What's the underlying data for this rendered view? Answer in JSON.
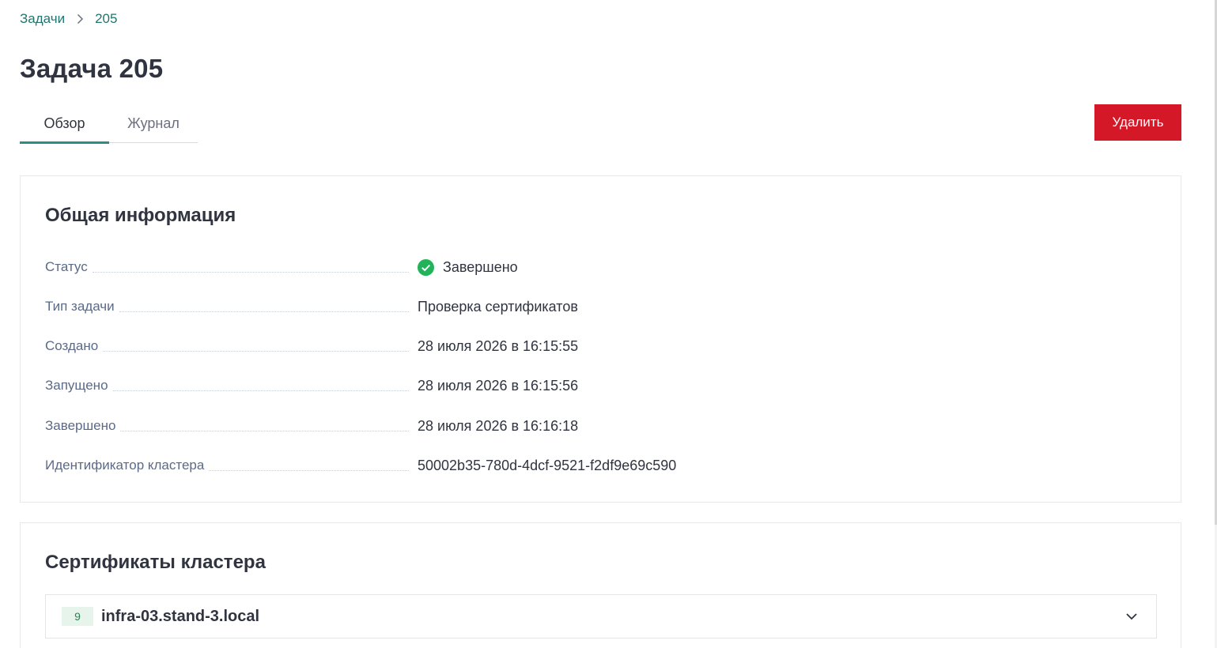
{
  "breadcrumb": {
    "root": "Задачи",
    "current": "205"
  },
  "page": {
    "title": "Задача 205"
  },
  "tabs": [
    {
      "label": "Обзор",
      "active": true
    },
    {
      "label": "Журнал",
      "active": false
    }
  ],
  "actions": {
    "delete_label": "Удалить"
  },
  "general": {
    "title": "Общая информация",
    "rows": [
      {
        "label": "Статус",
        "value": "Завершено",
        "icon": "check-circle-icon"
      },
      {
        "label": "Тип задачи",
        "value": "Проверка сертификатов"
      },
      {
        "label": "Создано",
        "value": "28 июля 2026 в 16:15:55"
      },
      {
        "label": "Запущено",
        "value": "28 июля 2026 в 16:15:56"
      },
      {
        "label": "Завершено",
        "value": "28 июля 2026 в 16:16:18"
      },
      {
        "label": "Идентификатор кластера",
        "value": "50002b35-780d-4dcf-9521-f2df9e69c590"
      }
    ]
  },
  "certificates": {
    "title": "Сертификаты кластера",
    "items": [
      {
        "count": "9",
        "host": "infra-03.stand-3.local"
      }
    ]
  },
  "colors": {
    "accent": "#2c8f86",
    "link": "#21756e",
    "danger": "#d41827",
    "success": "#22b35a"
  }
}
